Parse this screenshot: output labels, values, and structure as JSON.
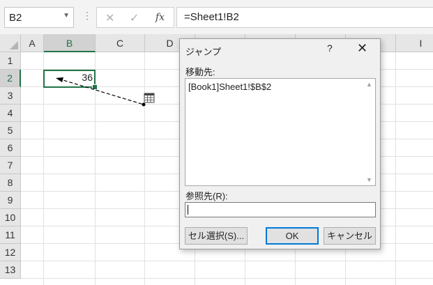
{
  "formula_bar": {
    "name_box": "B2",
    "separator": "⋮",
    "cancel_icon": "✕",
    "enter_icon": "✓",
    "fx_label": "fx",
    "formula": "=Sheet1!B2"
  },
  "grid": {
    "columns": [
      "A",
      "B",
      "C",
      "D",
      "",
      "",
      "",
      "",
      "I"
    ],
    "active_column": "B",
    "rows": [
      "1",
      "2",
      "3",
      "4",
      "5",
      "6",
      "7",
      "8",
      "9",
      "10",
      "11",
      "12",
      "13"
    ],
    "active_row": "2",
    "cells": {
      "B2": "36"
    }
  },
  "dialog": {
    "title": "ジャンプ",
    "help": "?",
    "close": "✕",
    "goto_label": "移動先:",
    "goto_items": [
      "[Book1]Sheet1!$B$2"
    ],
    "reference_label": "参照先(R):",
    "reference_value": "",
    "buttons": {
      "special": "セル選択(S)...",
      "ok": "OK",
      "cancel": "キャンセル"
    }
  },
  "colors": {
    "excel_green": "#217346",
    "ok_border": "#0078d7"
  }
}
